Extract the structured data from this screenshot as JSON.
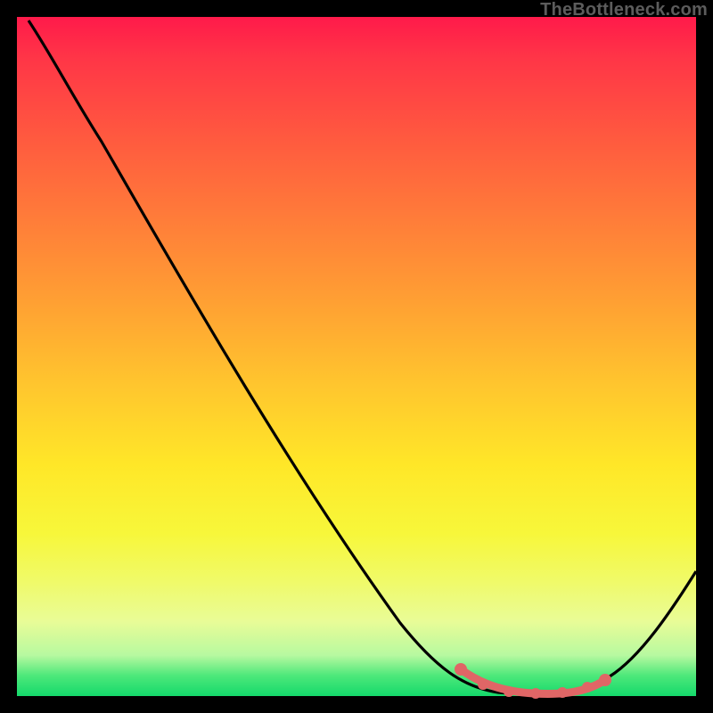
{
  "watermark": "TheBottleneck.com",
  "chart_data": {
    "type": "line",
    "title": "",
    "xlabel": "",
    "ylabel": "",
    "xlim": [
      0,
      100
    ],
    "ylim": [
      0,
      100
    ],
    "series": [
      {
        "name": "bottleneck-curve",
        "x": [
          0,
          6,
          12,
          18,
          24,
          30,
          36,
          42,
          48,
          54,
          60,
          64,
          68,
          72,
          76,
          80,
          84,
          90,
          96,
          100
        ],
        "y": [
          100,
          94,
          87,
          79,
          71,
          62,
          54,
          45,
          37,
          28,
          19,
          12,
          7,
          3,
          1,
          0,
          0,
          3,
          10,
          18
        ]
      },
      {
        "name": "highlight-band",
        "x": [
          66,
          68,
          70,
          73,
          76,
          79,
          82,
          85,
          87
        ],
        "y": [
          4,
          2,
          1.2,
          0.6,
          0.4,
          0.4,
          0.6,
          1.3,
          2.4
        ]
      }
    ],
    "gradient_stops": [
      {
        "pos": 0,
        "color": "#ff1a4a"
      },
      {
        "pos": 50,
        "color": "#ffc52e"
      },
      {
        "pos": 80,
        "color": "#f7f73a"
      },
      {
        "pos": 100,
        "color": "#14d96b"
      }
    ],
    "highlight_color": "#e06666",
    "curve_color": "#000000"
  }
}
